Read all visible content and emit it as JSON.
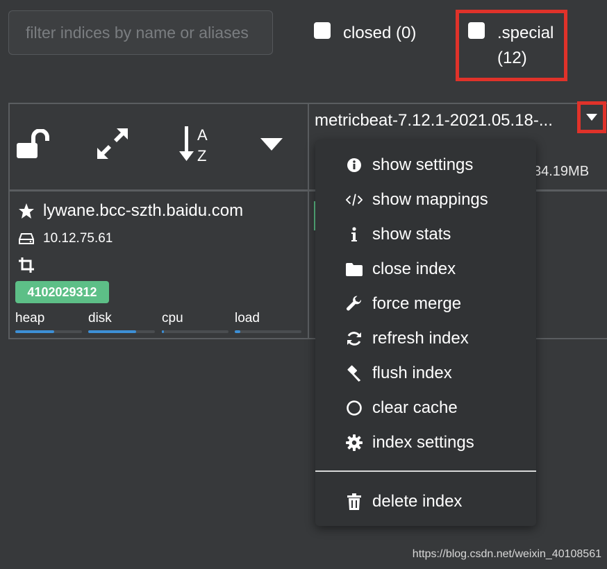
{
  "filter": {
    "placeholder": "filter indices by name or aliases"
  },
  "checkboxes": {
    "closed": {
      "label": "closed (0)"
    },
    "special": {
      "label_line1": ".special",
      "label_line2": "(12)"
    }
  },
  "toolbar_icons": [
    "lock-open-icon",
    "expand-icon",
    "sort-alpha-icon",
    "caret-down-icon"
  ],
  "index": {
    "title": "metricbeat-7.12.1-2021.05.18-...",
    "size": "34.19MB"
  },
  "node": {
    "name": "lywane.bcc-szth.baidu.com",
    "ip": "10.12.75.61",
    "id": "4102029312",
    "metrics": [
      {
        "label": "heap",
        "fill": 0.58
      },
      {
        "label": "disk",
        "fill": 0.72
      },
      {
        "label": "cpu",
        "fill": 0.03
      },
      {
        "label": "load",
        "fill": 0.08
      }
    ]
  },
  "menu": {
    "items": [
      {
        "label": "show settings",
        "icon": "info-circle-icon"
      },
      {
        "label": "show mappings",
        "icon": "code-icon"
      },
      {
        "label": "show stats",
        "icon": "info-icon"
      },
      {
        "label": "close index",
        "icon": "folder-icon"
      },
      {
        "label": "force merge",
        "icon": "wrench-icon"
      },
      {
        "label": "refresh index",
        "icon": "refresh-icon"
      },
      {
        "label": "flush index",
        "icon": "gavel-icon"
      },
      {
        "label": "clear cache",
        "icon": "circle-icon"
      },
      {
        "label": "index settings",
        "icon": "gear-icon"
      }
    ],
    "delete": {
      "label": "delete index",
      "icon": "trash-icon"
    }
  },
  "watermark": "https://blog.csdn.net/weixin_40108561",
  "colors": {
    "background": "#37393b",
    "highlight": "#e0322a",
    "badge": "#5dbf87",
    "bar": "#3d8fd6"
  }
}
